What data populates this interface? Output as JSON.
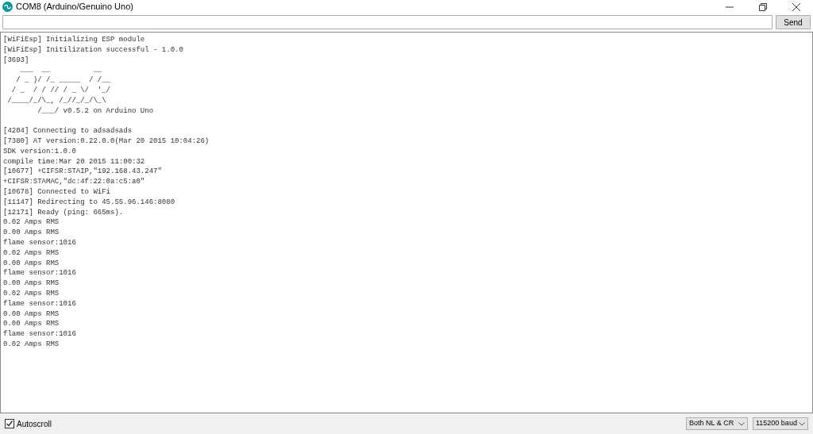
{
  "window": {
    "title": "COM8 (Arduino/Genuino Uno)"
  },
  "send_button": "Send",
  "output_lines": [
    "[WiFiEsp] Initializing ESP module",
    "[WiFiEsp] Initilization successful - 1.0.0",
    "[3693]",
    "    ___  __          __",
    "   / _ )/ /_ _____  / /__",
    "  / _  / / // / _ \\/  '_/",
    " /____/_/\\_, /_//_/_/\\_\\",
    "        /___/ v0.5.2 on Arduino Uno",
    "[4204] Connecting to adsadsads",
    "[7380] AT version:0.22.0.0(Mar 20 2015 10:04:26)",
    "SDK version:1.0.0",
    "compile time:Mar 20 2015 11:00:32",
    "[10677] +CIFSR:STAIP,\"192.168.43.247\"",
    "+CIFSR:STAMAC,\"dc:4f:22:0a:c5:a0\"",
    "[10678] Connected to WiFi",
    "[11147] Redirecting to 45.55.96.146:8080",
    "[12171] Ready (ping: 665ms).",
    "0.02 Amps RMS",
    "0.00 Amps RMS",
    "flame sensor:1016",
    "0.02 Amps RMS",
    "0.00 Amps RMS",
    "flame sensor:1016",
    "0.00 Amps RMS",
    "0.02 Amps RMS",
    "flame sensor:1016",
    "0.00 Amps RMS",
    "0.00 Amps RMS",
    "flame sensor:1016",
    "0.02 Amps RMS"
  ],
  "autoscroll": {
    "label": "Autoscroll",
    "checked": true
  },
  "line_ending": "Both NL & CR",
  "baud_rate": "115200 baud"
}
